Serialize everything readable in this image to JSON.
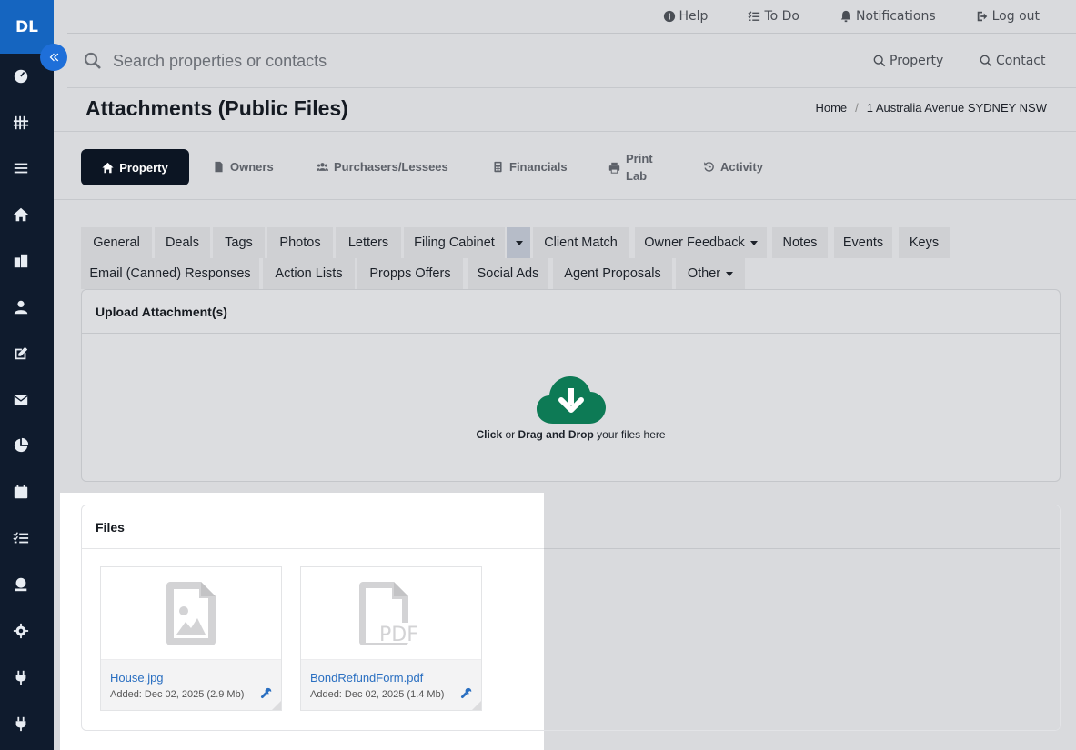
{
  "sidebar": {
    "logo": "DL",
    "items": [
      {
        "icon": "dashboard-icon"
      },
      {
        "icon": "pipeline-icon"
      },
      {
        "icon": "list-icon"
      },
      {
        "icon": "home-icon"
      },
      {
        "icon": "buildings-icon"
      },
      {
        "icon": "person-icon"
      },
      {
        "icon": "edit-icon"
      },
      {
        "icon": "mail-icon"
      },
      {
        "icon": "pie-chart-icon"
      },
      {
        "icon": "calendar-icon"
      },
      {
        "icon": "checklist-icon"
      },
      {
        "icon": "money-icon"
      },
      {
        "icon": "gear-icon"
      },
      {
        "icon": "plug-icon"
      },
      {
        "icon": "plug-icon"
      }
    ]
  },
  "topbar": {
    "help": "Help",
    "todo": "To Do",
    "notifications": "Notifications",
    "logout": "Log out"
  },
  "search": {
    "placeholder": "Search properties or contacts",
    "property": "Property",
    "contact": "Contact"
  },
  "page": {
    "title": "Attachments (Public Files)",
    "breadcrumb": {
      "home": "Home",
      "separator": "/",
      "current": "1 Australia Avenue SYDNEY NSW"
    }
  },
  "entity_tabs": {
    "property": "Property",
    "owners": "Owners",
    "purchasers": "Purchasers/Lessees",
    "financials": "Financials",
    "print_lab_1": "Print",
    "print_lab_2": "Lab",
    "activity": "Activity"
  },
  "sub_tabs": {
    "general": "General",
    "deals": "Deals",
    "tags": "Tags",
    "photos": "Photos",
    "letters": "Letters",
    "filing_cabinet": "Filing Cabinet",
    "client_match": "Client Match",
    "owner_feedback": "Owner Feedback",
    "notes": "Notes",
    "events": "Events",
    "keys": "Keys",
    "email_responses": "Email (Canned) Responses",
    "action_lists": "Action Lists",
    "propps_offers": "Propps Offers",
    "social_ads": "Social Ads",
    "agent_proposals": "Agent Proposals",
    "other": "Other"
  },
  "upload": {
    "title": "Upload Attachment(s)",
    "click": "Click",
    "or": " or ",
    "drag": "Drag and Drop",
    "rest": " your files here"
  },
  "files": {
    "title": "Files",
    "items": [
      {
        "name": "House.jpg",
        "added": "Added: Dec 02, 2025 (2.9 Mb)",
        "type_icon": "image-file-icon"
      },
      {
        "name": "BondRefundForm.pdf",
        "added": "Added: Dec 02, 2025 (1.4 Mb)",
        "type_icon": "pdf-file-icon"
      }
    ]
  },
  "colors": {
    "sidebar": "#0f1b2d",
    "logo": "#1565c0",
    "accent": "#1e6fd9",
    "cloud": "#0d7a55",
    "link": "#2a6fc1",
    "active_tab": "#0c1523"
  }
}
